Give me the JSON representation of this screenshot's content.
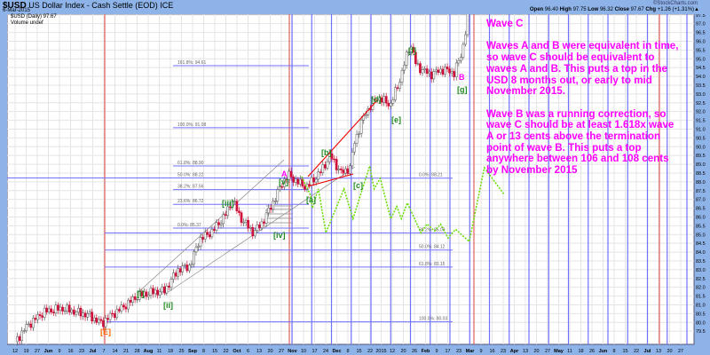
{
  "header": {
    "symbol": "$USD",
    "name": "US Dollar Index - Cash Settle (EOD) ICE",
    "date": "6-Mar-2015",
    "brand": "©StockCharts.com",
    "open_label": "Open",
    "open": "96.40",
    "high_label": "High",
    "high": "97.75",
    "low_label": "Low",
    "low": "96.32",
    "close_label": "Close",
    "close": "97.67",
    "chg_label": "Chg",
    "chg": "+1.26 (+1.31%)▲"
  },
  "legend": {
    "series": "$USD (Daily) 97.67",
    "volume": "Volume undef"
  },
  "annotation": {
    "title": "Wave C",
    "p1": "Waves A and B were equivalent in time, so wave C should be equivalent to waves A and B. This puts a top in the USD 8 months out, or early to mid November 2015.",
    "p2": "Wave B was a running correction, so wave C should be at least 1.618x wave A or 13 cents above the termination point of wave B. This puts a top anywhere between 106 and 108 cents by November 2015"
  },
  "colors": {
    "up": "#ffffff",
    "down": "#d0103a",
    "fib": "#7070ff",
    "projection": "#66dd00",
    "wave": "#228b22",
    "abc": "#ff00ff",
    "e": "#ff6600",
    "timeline": "#e06060"
  },
  "chart_data": {
    "type": "candlestick",
    "title": "$USD US Dollar Index - Cash Settle (EOD)",
    "ylim": [
      79.0,
      97.5
    ],
    "yticks": [
      "97.5",
      "97.0",
      "96.5",
      "96.0",
      "95.5",
      "95.0",
      "94.5",
      "94.0",
      "93.5",
      "93.0",
      "92.5",
      "92.0",
      "91.5",
      "91.0",
      "90.5",
      "90.0",
      "89.5",
      "89.0",
      "88.5",
      "88.0",
      "87.5",
      "87.0",
      "86.5",
      "86.0",
      "85.5",
      "85.0",
      "84.5",
      "84.0",
      "83.5",
      "83.0",
      "82.5",
      "82.0",
      "81.5",
      "81.0",
      "80.5",
      "80.0",
      "79.5"
    ],
    "xticks": [
      "12",
      "19",
      "27",
      "Jun",
      "9",
      "16",
      "23",
      "Jul",
      "7",
      "14",
      "21",
      "28",
      "Aug",
      "11",
      "18",
      "25",
      "Sep",
      "8",
      "15",
      "22",
      "Oct",
      "6",
      "13",
      "20",
      "27",
      "Nov",
      "10",
      "17",
      "24",
      "Dec",
      "8",
      "15",
      "22",
      "2015",
      "12",
      "20",
      "26",
      "Feb",
      "9",
      "17",
      "23",
      "Mar",
      "9",
      "16",
      "23",
      "Apr",
      "13",
      "20",
      "27",
      "May",
      "11",
      "18",
      "26",
      "Jun",
      "8",
      "15",
      "22",
      "Jul",
      "13",
      "20",
      "27"
    ],
    "price_keypoints_day_close": [
      [
        0,
        78.9
      ],
      [
        8,
        79.8
      ],
      [
        19,
        80.6
      ],
      [
        31,
        80.8
      ],
      [
        49,
        80.4
      ],
      [
        58,
        79.9
      ],
      [
        59,
        80.1
      ],
      [
        72,
        80.9
      ],
      [
        81,
        81.5
      ],
      [
        90,
        81.7
      ],
      [
        99,
        81.8
      ],
      [
        108,
        83.0
      ],
      [
        116,
        83.2
      ],
      [
        122,
        84.7
      ],
      [
        131,
        85.2
      ],
      [
        140,
        86.2
      ],
      [
        144,
        87.0
      ],
      [
        149,
        86.0
      ],
      [
        158,
        85.1
      ],
      [
        164,
        85.7
      ],
      [
        172,
        87.0
      ],
      [
        177,
        87.9
      ],
      [
        181,
        88.4
      ],
      [
        187,
        88.0
      ],
      [
        193,
        87.7
      ],
      [
        202,
        88.5
      ],
      [
        209,
        89.5
      ],
      [
        216,
        88.5
      ],
      [
        222,
        88.8
      ],
      [
        225,
        90.3
      ],
      [
        232,
        91.9
      ],
      [
        240,
        92.8
      ],
      [
        249,
        92.4
      ],
      [
        255,
        93.8
      ],
      [
        262,
        95.9
      ],
      [
        266,
        94.6
      ],
      [
        275,
        94.1
      ],
      [
        284,
        94.4
      ],
      [
        291,
        94.2
      ],
      [
        296,
        95.3
      ],
      [
        300,
        97.3
      ]
    ],
    "projection_day_value": [
      [
        190,
        88.3
      ],
      [
        196,
        87.2
      ],
      [
        197,
        86.5
      ],
      [
        201,
        87.6
      ],
      [
        206,
        85.1
      ],
      [
        218,
        87.6
      ],
      [
        224,
        85.9
      ],
      [
        235,
        88.9
      ],
      [
        238,
        87.6
      ],
      [
        242,
        88.2
      ],
      [
        249,
        85.9
      ],
      [
        253,
        86.6
      ],
      [
        256,
        85.9
      ],
      [
        260,
        86.8
      ],
      [
        269,
        85.1
      ],
      [
        273,
        85.6
      ],
      [
        278,
        85.2
      ],
      [
        282,
        85.6
      ],
      [
        287,
        84.8
      ],
      [
        292,
        85.3
      ],
      [
        301,
        84.6
      ],
      [
        311,
        88.8
      ],
      [
        324,
        87.3
      ]
    ],
    "fib_levels": [
      {
        "label": "161.8%: 94.61",
        "value": 94.61
      },
      {
        "label": "100.0%: 91.08",
        "value": 91.08
      },
      {
        "label": "61.8%: 88.90",
        "value": 88.9
      },
      {
        "label": "50.0%: 88.22",
        "value": 88.22
      },
      {
        "label": "38.2%: 87.56",
        "value": 87.56
      },
      {
        "label": "23.6%: 86.72",
        "value": 86.72
      },
      {
        "label": "0.0%: 85.37",
        "value": 85.37
      },
      {
        "label": "0.0%: 88.21",
        "value": 88.21
      },
      {
        "label": "38.2%: 85.09",
        "value": 85.09
      },
      {
        "label": "50.0%: 84.12",
        "value": 84.12
      },
      {
        "label": "61.8%: 83.15",
        "value": 83.15
      },
      {
        "label": "100.0%: 80.03",
        "value": 80.03
      }
    ],
    "wave_labels": [
      "[E]",
      "[i]",
      "[ii]",
      "[iii]",
      "[iv]",
      "[v]",
      "A",
      "[a]",
      "[b]",
      "[c]",
      "[d]",
      "[e]",
      "[f]",
      "B",
      "[g]"
    ]
  }
}
